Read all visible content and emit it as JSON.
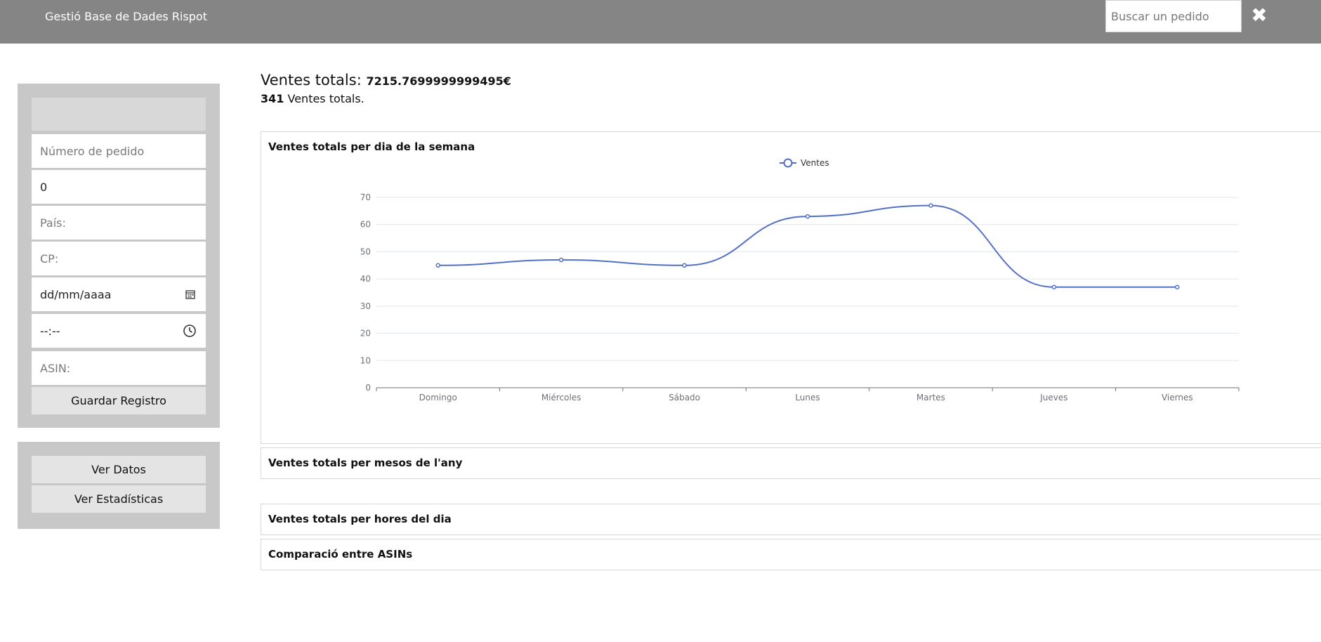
{
  "header": {
    "title": "Gestió Base de Dades Rispot",
    "search_placeholder": "Buscar un pedido",
    "close_glyph": "✖"
  },
  "form": {
    "order_number_placeholder": "Número de pedido",
    "quantity_value": "0",
    "country_placeholder": "País:",
    "postal_code_placeholder": "CP:",
    "date_value": "dd/mm/aaaa",
    "time_value": "--:--",
    "asin_placeholder": "ASIN:",
    "save_label": "Guardar Registro"
  },
  "nav": {
    "view_data_label": "Ver Datos",
    "view_stats_label": "Ver Estadísticas"
  },
  "summary": {
    "total_sales_label": "Ventes totals:",
    "total_sales_amount": "7215.7699999999495€",
    "sales_count": "341",
    "sales_count_label": "Ventes totals."
  },
  "sections": {
    "weekday_title": "Ventes totals per dia de la semana",
    "months_title": "Ventes totals per mesos de l'any",
    "hours_title": "Ventes totals per hores del dia",
    "asin_title": "Comparació entre ASINs"
  },
  "chart_data": {
    "type": "line",
    "smooth": true,
    "categories": [
      "Domingo",
      "Miércoles",
      "Sábado",
      "Lunes",
      "Martes",
      "Jueves",
      "Viernes"
    ],
    "series": [
      {
        "name": "Ventes",
        "values": [
          45,
          47,
          45,
          63,
          67,
          37,
          37
        ]
      }
    ],
    "ylim": [
      0,
      70
    ],
    "yticks": [
      0,
      10,
      20,
      30,
      40,
      50,
      60,
      70
    ],
    "legend_position": "top-center",
    "grid": true,
    "color": "#5470c6"
  },
  "icons": {
    "close": "close-icon",
    "calendar": "calendar-icon",
    "clock": "clock-icon"
  }
}
